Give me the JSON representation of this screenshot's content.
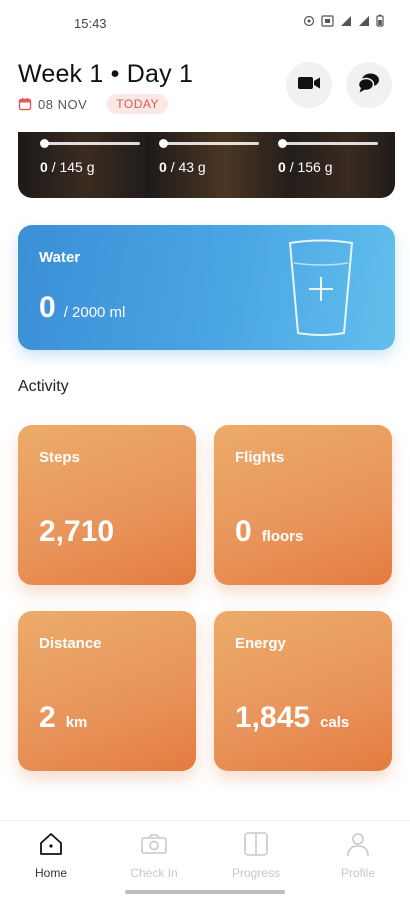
{
  "status_bar": {
    "time": "15:43"
  },
  "header": {
    "title": "Week 1 • Day 1",
    "date": "08 NOV",
    "today_badge": "TODAY"
  },
  "macros": [
    {
      "value": "0",
      "target": "/ 145 g"
    },
    {
      "value": "0",
      "target": "/ 43 g"
    },
    {
      "value": "0",
      "target": "/ 156 g"
    }
  ],
  "water": {
    "label": "Water",
    "value": "0",
    "target": "/ 2000 ml"
  },
  "activity": {
    "title": "Activity",
    "steps": {
      "label": "Steps",
      "value": "2,710",
      "unit": ""
    },
    "flights": {
      "label": "Flights",
      "value": "0",
      "unit": "floors"
    },
    "distance": {
      "label": "Distance",
      "value": "2",
      "unit": "km"
    },
    "energy": {
      "label": "Energy",
      "value": "1,845",
      "unit": "cals"
    }
  },
  "nav": {
    "home": "Home",
    "checkin": "Check In",
    "progress": "Progress",
    "profile": "Profile"
  },
  "colors": {
    "accent_red": "#e05a52",
    "water_blue": "#4aa5e4",
    "activity_orange": "#e8935a"
  },
  "icons": [
    "calendar-icon",
    "video-icon",
    "chat-icon",
    "cup-plus-icon",
    "home-icon",
    "camera-icon",
    "progress-icon",
    "profile-icon"
  ]
}
